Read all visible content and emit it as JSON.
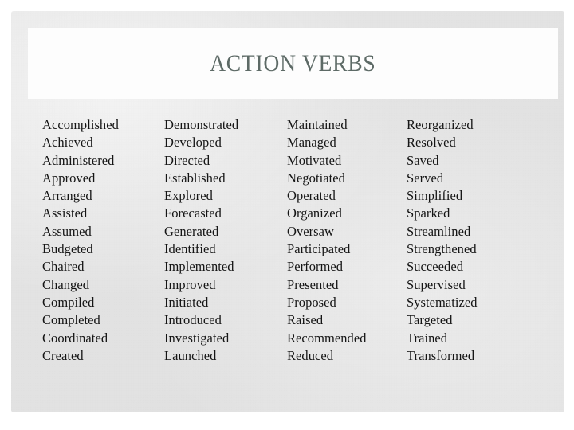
{
  "slide": {
    "title": "ACTION VERBS",
    "colors": {
      "page_background": "#ffffff",
      "slide_background": "#e3e3e3",
      "title_panel_background": "#fdfdfd",
      "title_text": "#5d6a66",
      "body_text": "#151515"
    }
  },
  "columns": [
    {
      "id": "column-1",
      "items": [
        "Accomplished",
        "Achieved",
        "Administered",
        "Approved",
        "Arranged",
        "Assisted",
        "Assumed",
        "Budgeted",
        "Chaired",
        "Changed",
        "Compiled",
        "Completed",
        "Coordinated",
        "Created"
      ]
    },
    {
      "id": "column-2",
      "items": [
        "Demonstrated",
        "Developed",
        "Directed",
        "Established",
        "Explored",
        "Forecasted",
        "Generated",
        "Identified",
        "Implemented",
        "Improved",
        "Initiated",
        "Introduced",
        "Investigated",
        "Launched"
      ]
    },
    {
      "id": "column-3",
      "items": [
        "Maintained",
        "Managed",
        "Motivated",
        "Negotiated",
        "Operated",
        "Organized",
        "Oversaw",
        "Participated",
        "Performed",
        "Presented",
        "Proposed",
        "Raised",
        "Recommended",
        "Reduced"
      ]
    },
    {
      "id": "column-4",
      "items": [
        "Reorganized",
        "Resolved",
        "Saved",
        "Served",
        "Simplified",
        "Sparked",
        "Streamlined",
        "Strengthened",
        "Succeeded",
        "Supervised",
        "Systematized",
        "Targeted",
        "Trained",
        "Transformed"
      ]
    }
  ]
}
